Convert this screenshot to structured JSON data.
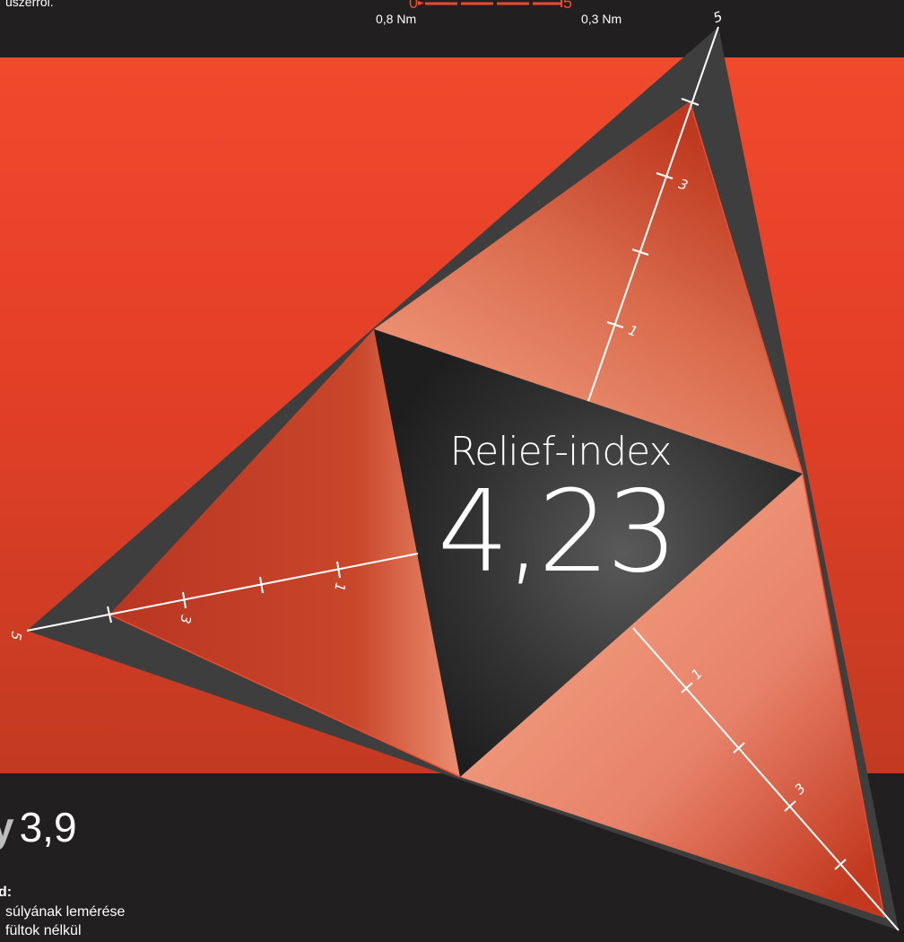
{
  "header": {
    "cut_text": "úszerről.",
    "scale_left_value": "0",
    "scale_right_value": "5",
    "scale_left_label": "0,8 Nm",
    "scale_right_label": "0,3 Nm"
  },
  "chart": {
    "title": "Relief-index",
    "value": "4,23",
    "axis_ticks": [
      "1",
      "3",
      "5"
    ]
  },
  "bottom": {
    "score_prefix": "y",
    "score_value": "3,9",
    "method_title": "d:",
    "method_line1": "súlyának lemérése",
    "method_line2": "fültok nélkül"
  },
  "colors": {
    "background": "#211f20",
    "band": "#f04a2d",
    "accent": "#f04a2d"
  }
}
